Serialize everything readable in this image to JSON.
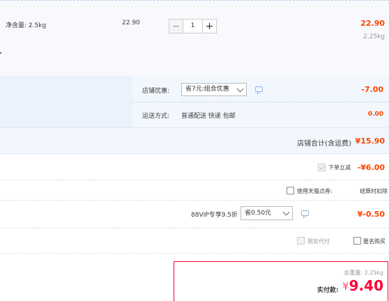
{
  "item": {
    "spec": "净含量: 2.5kg",
    "unit_price": "22.90",
    "qty_minus": "−",
    "qty_value": "1",
    "qty_plus": "+",
    "subtotal": "22.90",
    "weight": "2.25kg"
  },
  "promotions": {
    "shop_discount_label": "店铺优惠:",
    "shop_discount_select": "省7元:组合优惠",
    "shop_discount_value": "-7.00",
    "shipping_label": "运送方式:",
    "shipping_value": "普通配送 快递 包邮",
    "shipping_price": "0.00"
  },
  "shop_total": {
    "label": "店铺合计(含运费)",
    "value": "¥15.90"
  },
  "order_discount": {
    "label": "下单立减",
    "value": "-¥6.00"
  },
  "points": {
    "label": "使用天猫点券:",
    "value": "结算时扣除"
  },
  "vip": {
    "label": "88VIP专享9.5折",
    "select": "省0.50元",
    "value": "¥-0.50"
  },
  "options": {
    "friend_pay": "朋友代付",
    "anonymous": "匿名购买"
  },
  "final": {
    "weight_label": "总重量: 2.25kg",
    "pay_label": "实付款:",
    "currency": "¥",
    "amount": "9.40"
  },
  "colors": {
    "price_red": "#ff4400",
    "accent_red": "#ff0036",
    "panel_blue": "#eaf2fb"
  }
}
